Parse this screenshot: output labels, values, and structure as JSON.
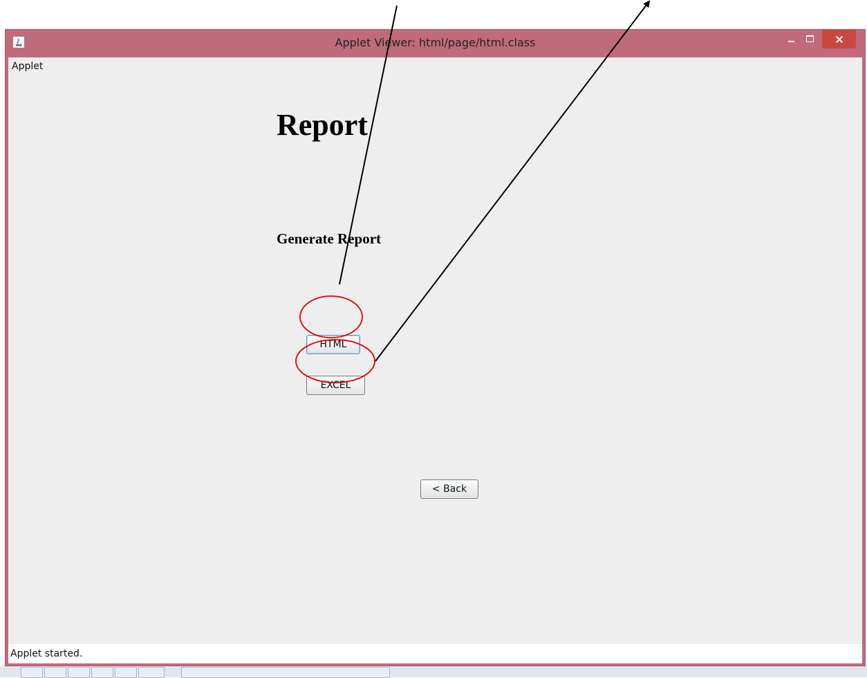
{
  "window": {
    "title": "Applet Viewer: html/page/html.class"
  },
  "menubar": {
    "applet_menu": "Applet"
  },
  "content": {
    "heading": "Report",
    "subheading": "Generate Report",
    "html_button": "HTML",
    "excel_button": "EXCEL",
    "back_button": "< Back"
  },
  "status": {
    "text": "Applet started."
  },
  "colors": {
    "window_frame": "#c06a7c",
    "close_button": "#c9483e",
    "client_background": "#eeeeee",
    "annotation_circle": "#e00000",
    "annotation_arrow": "#000000"
  },
  "icons": [
    "java-applet-icon",
    "minimize-icon",
    "maximize-icon",
    "close-icon"
  ]
}
